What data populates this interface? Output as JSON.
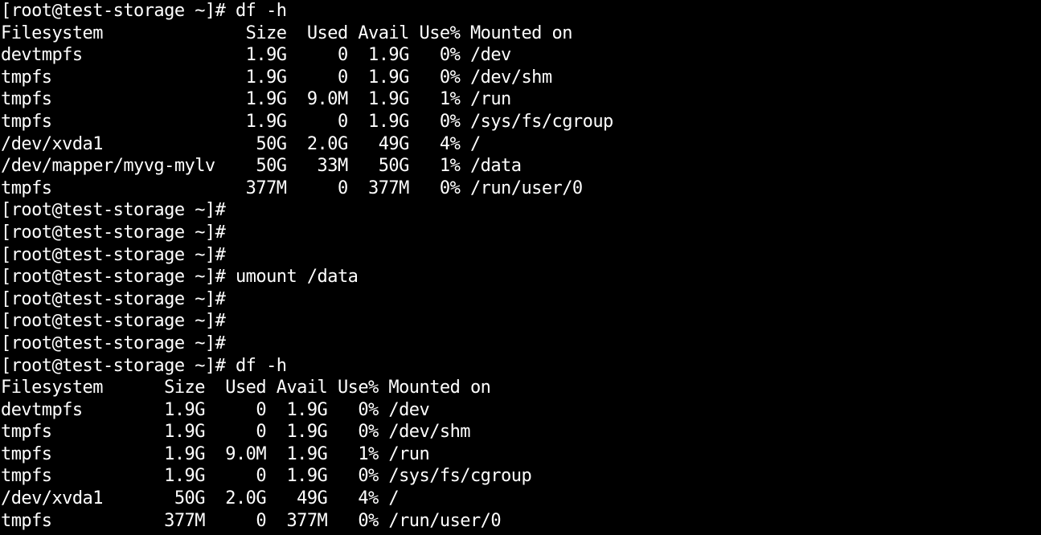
{
  "terminal": {
    "lines": [
      "[root@test-storage ~]# df -h",
      "Filesystem              Size  Used Avail Use% Mounted on",
      "devtmpfs                1.9G     0  1.9G   0% /dev",
      "tmpfs                   1.9G     0  1.9G   0% /dev/shm",
      "tmpfs                   1.9G  9.0M  1.9G   1% /run",
      "tmpfs                   1.9G     0  1.9G   0% /sys/fs/cgroup",
      "/dev/xvda1               50G  2.0G   49G   4% /",
      "/dev/mapper/myvg-mylv    50G   33M   50G   1% /data",
      "tmpfs                   377M     0  377M   0% /run/user/0",
      "[root@test-storage ~]#",
      "[root@test-storage ~]#",
      "[root@test-storage ~]#",
      "[root@test-storage ~]# umount /data",
      "[root@test-storage ~]#",
      "[root@test-storage ~]#",
      "[root@test-storage ~]#",
      "[root@test-storage ~]# df -h",
      "Filesystem      Size  Used Avail Use% Mounted on",
      "devtmpfs        1.9G     0  1.9G   0% /dev",
      "tmpfs           1.9G     0  1.9G   0% /dev/shm",
      "tmpfs           1.9G  9.0M  1.9G   1% /run",
      "tmpfs           1.9G     0  1.9G   0% /sys/fs/cgroup",
      "/dev/xvda1       50G  2.0G   49G   4% /",
      "tmpfs           377M     0  377M   0% /run/user/0"
    ]
  },
  "colors": {
    "background": "#000000",
    "foreground": "#ffffff"
  }
}
